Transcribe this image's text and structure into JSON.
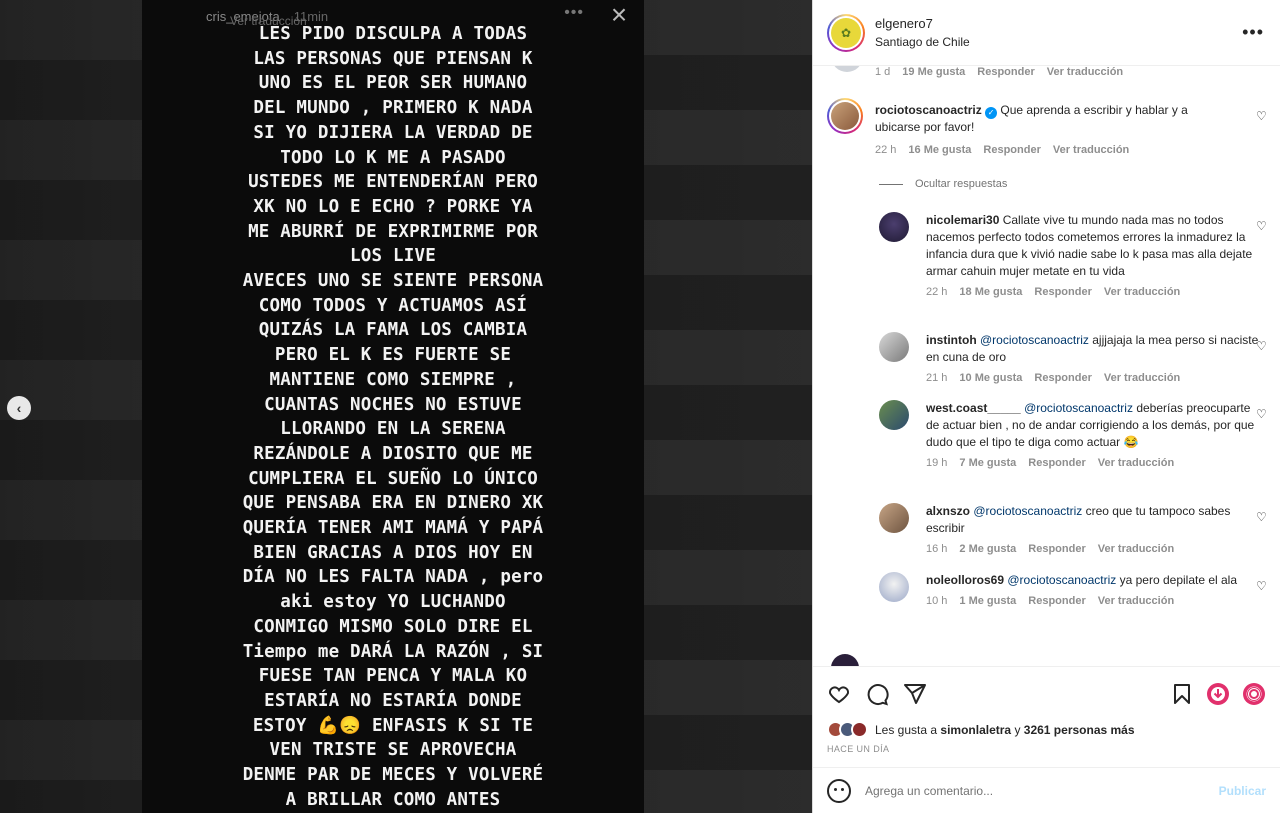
{
  "story": {
    "username": "cris_emejota",
    "time": "11min",
    "translate": "Ver traducción",
    "close": "×",
    "text": "LES PIDO DISCULPA A TODAS\nLAS PERSONAS QUE PIENSAN K\nUNO ES EL PEOR SER HUMANO\nDEL MUNDO , PRIMERO K NADA\nSI YO DIJIERA LA VERDAD DE\nTODO LO K ME A PASADO\nUSTEDES ME ENTENDERÍAN PERO\nXK NO LO E ECHO ? PORKE YA\nME ABURRÍ DE EXPRIMIRME POR\nLOS LIVE\nAVECES UNO SE SIENTE PERSONA\nCOMO TODOS Y ACTUAMOS ASÍ\nQUIZÁS LA FAMA LOS CAMBIA\nPERO EL K ES FUERTE SE\nMANTIENE COMO SIEMPRE ,\nCUANTAS NOCHES NO ESTUVE\nLLORANDO EN LA SERENA\nREZÁNDOLE A DIOSITO QUE ME\nCUMPLIERA EL SUEÑO LO ÚNICO\nQUE PENSABA ERA EN DINERO XK\nQUERÍA TENER AMI MAMÁ Y PAPÁ\nBIEN GRACIAS A DIOS HOY EN\nDÍA NO LES FALTA NADA , pero\naki estoy YO LUCHANDO\nCONMIGO MISMO SOLO DIRE EL\nTiempo me DARÁ LA RAZÓN , SI\nFUESE TAN PENCA Y MALA KO\nESTARÍA NO ESTARÍA DONDE\nESTOY 💪😞 ENFASIS K SI TE\nVEN TRISTE SE APROVECHA\nDENME PAR DE MECES Y VOLVERÉ\nA BRILLAR COMO ANTES"
  },
  "post": {
    "username": "elgenero7",
    "location": "Santiago de Chile",
    "more": "•••"
  },
  "top_meta": {
    "time": "1 d",
    "likes": "19 Me gusta",
    "reply": "Responder",
    "translate": "Ver traducción"
  },
  "main_comment": {
    "username": "rociotoscanoactriz",
    "text": "Que aprenda a escribir y hablar y a ubicarse por favor!",
    "time": "22 h",
    "likes": "16 Me gusta",
    "reply": "Responder",
    "translate": "Ver traducción"
  },
  "hide_replies": "Ocultar respuestas",
  "replies": [
    {
      "username": "nicolemari30",
      "mention": "",
      "text": "Callate vive tu mundo nada mas no todos nacemos perfecto todos cometemos errores la inmadurez la infancia dura que k vivió nadie sabe lo k pasa mas alla dejate armar cahuin mujer metate en tu vida",
      "time": "22 h",
      "likes": "18 Me gusta",
      "reply": "Responder",
      "translate": "Ver traducción"
    },
    {
      "username": "instintoh",
      "mention": "@rociotoscanoactriz",
      "text": "ajjjajaja la mea perso si naciste en cuna de oro",
      "time": "21 h",
      "likes": "10 Me gusta",
      "reply": "Responder",
      "translate": "Ver traducción"
    },
    {
      "username": "west.coast_____",
      "mention": "@rociotoscanoactriz",
      "text": "deberías preocuparte de actuar bien , no de andar corrigiendo a los demás, por que dudo que el tipo te diga como actuar 😂",
      "time": "19 h",
      "likes": "7 Me gusta",
      "reply": "Responder",
      "translate": "Ver traducción"
    },
    {
      "username": "alxnszo",
      "mention": "@rociotoscanoactriz",
      "text": "creo que tu tampoco sabes escribir",
      "time": "16 h",
      "likes": "2 Me gusta",
      "reply": "Responder",
      "translate": "Ver traducción"
    },
    {
      "username": "noleolloros69",
      "mention": "@rociotoscanoactriz",
      "text": "ya pero depilate el ala",
      "time": "10 h",
      "likes": "1 Me gusta",
      "reply": "Responder",
      "translate": "Ver traducción"
    }
  ],
  "likes_line": {
    "prefix": "Les gusta a",
    "user": "simonlaletra",
    "middle": "y",
    "count": "3261 personas más"
  },
  "time_ago": "HACE UN DÍA",
  "add_comment": {
    "placeholder": "Agrega un comentario...",
    "publish": "Publicar"
  },
  "colors": {
    "accent": "#0095f6",
    "publish_disabled": "#b2dffc",
    "mention": "#00376b"
  }
}
